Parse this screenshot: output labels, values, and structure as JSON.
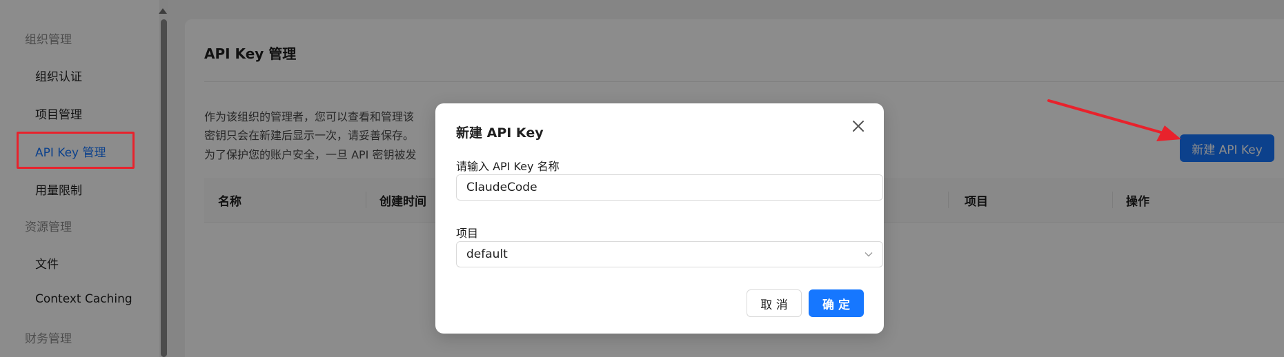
{
  "sidebar": {
    "groups": [
      {
        "label": "组织管理"
      },
      {
        "label": "资源管理"
      },
      {
        "label": "财务管理"
      }
    ],
    "items": [
      {
        "label": "组织认证"
      },
      {
        "label": "项目管理"
      },
      {
        "label": "API Key 管理"
      },
      {
        "label": "用量限制"
      },
      {
        "label": "文件"
      },
      {
        "label": "Context Caching"
      }
    ],
    "active_item": "API Key 管理"
  },
  "main": {
    "title": "API Key 管理",
    "description_lines": [
      "作为该组织的管理者，您可以查看和管理该",
      "密钥只会在新建后显示一次，请妥善保存。",
      "为了保护您的账户安全，一旦 API 密钥被发"
    ],
    "new_key_button": "新建 API Key",
    "table": {
      "columns": [
        "名称",
        "创建时间",
        "项目",
        "操作"
      ]
    }
  },
  "modal": {
    "title": "新建 API Key",
    "name_field": {
      "label": "请输入 API Key 名称",
      "value": "ClaudeCode"
    },
    "project_field": {
      "label": "项目",
      "value": "default"
    },
    "cancel_label": "取 消",
    "confirm_label": "确 定"
  },
  "colors": {
    "primary": "#1677ff",
    "highlight_red": "#e8222c",
    "overlay": "rgba(0,0,0,0.45)"
  },
  "icons": {
    "close": "close-icon",
    "select": "chevron-down-icon",
    "annotation": "red-arrow"
  }
}
